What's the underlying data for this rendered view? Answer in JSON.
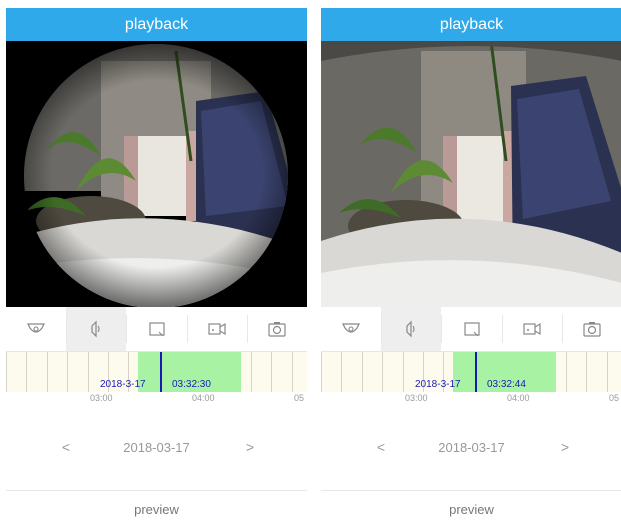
{
  "screens": [
    {
      "title": "playback",
      "tools": [
        "camera-view-icon",
        "speaker-icon",
        "screen-icon",
        "video-record-icon",
        "snapshot-icon"
      ],
      "active_tool": 1,
      "timeline": {
        "date_tag": "2018-3-17",
        "time_tag": "03:32:30",
        "hour_labels": [
          "03:00",
          "04:00",
          "05"
        ],
        "recording_fraction": [
          0.44,
          0.78
        ],
        "cursor_fraction": 0.51
      },
      "date": "2018-03-17",
      "prev_arrow": "<",
      "next_arrow": ">",
      "preview_label": "preview"
    },
    {
      "title": "playback",
      "tools": [
        "camera-view-icon",
        "speaker-icon",
        "screen-icon",
        "video-record-icon",
        "snapshot-icon"
      ],
      "active_tool": 1,
      "timeline": {
        "date_tag": "2018-3-17",
        "time_tag": "03:32:44",
        "hour_labels": [
          "03:00",
          "04:00",
          "05"
        ],
        "recording_fraction": [
          0.44,
          0.78
        ],
        "cursor_fraction": 0.51
      },
      "date": "2018-03-17",
      "prev_arrow": "<",
      "next_arrow": ">",
      "preview_label": "preview"
    }
  ],
  "colors": {
    "header": "#2fa9ea",
    "recording": "#a7f2a3",
    "timeline_bg": "#fdfaee",
    "cursor": "#1a1ab8"
  }
}
